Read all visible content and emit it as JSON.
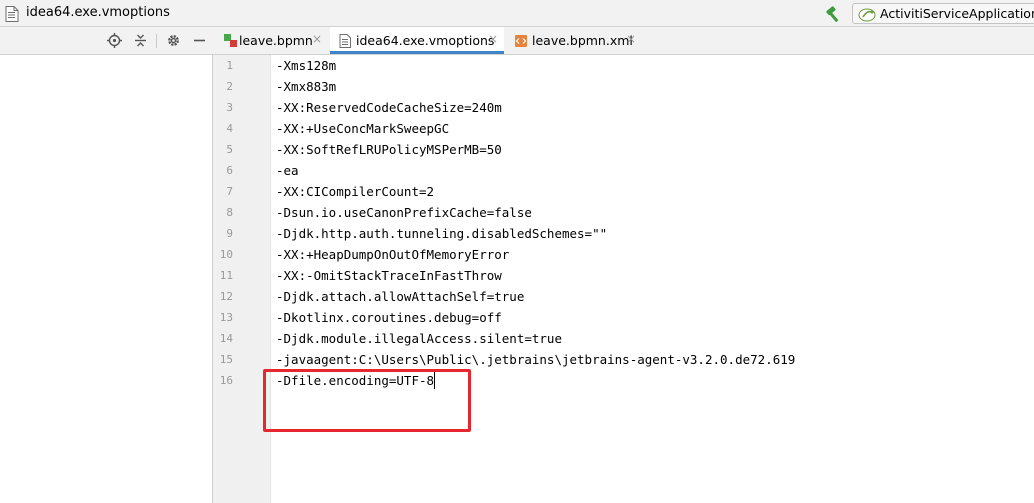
{
  "window": {
    "title": "idea64.exe.vmoptions",
    "run_config": "ActivitiServiceApplication"
  },
  "tabs": [
    {
      "label": "leave.bpmn",
      "active": false,
      "icon": "bpmn-file-icon"
    },
    {
      "label": "idea64.exe.vmoptions",
      "active": true,
      "icon": "text-file-icon"
    },
    {
      "label": "leave.bpmn.xml",
      "active": false,
      "icon": "xml-file-icon"
    }
  ],
  "tabs_close_glyph": "×",
  "toolbar_icons": [
    "locate-icon",
    "collapse-all-icon",
    "settings-icon",
    "hide-icon"
  ],
  "editor": {
    "current_line": 16,
    "lines": [
      {
        "num": "1",
        "text": "-Xms128m"
      },
      {
        "num": "2",
        "text": "-Xmx883m"
      },
      {
        "num": "3",
        "text": "-XX:ReservedCodeCacheSize=240m"
      },
      {
        "num": "4",
        "text": "-XX:+UseConcMarkSweepGC"
      },
      {
        "num": "5",
        "text": "-XX:SoftRefLRUPolicyMSPerMB=50"
      },
      {
        "num": "6",
        "text": "-ea"
      },
      {
        "num": "7",
        "text": "-XX:CICompilerCount=2"
      },
      {
        "num": "8",
        "text": "-Dsun.io.useCanonPrefixCache=false"
      },
      {
        "num": "9",
        "text": "-Djdk.http.auth.tunneling.disabledSchemes=\"\""
      },
      {
        "num": "10",
        "text": "-XX:+HeapDumpOnOutOfMemoryError"
      },
      {
        "num": "11",
        "text": "-XX:-OmitStackTraceInFastThrow"
      },
      {
        "num": "12",
        "text": "-Djdk.attach.allowAttachSelf=true"
      },
      {
        "num": "13",
        "text": "-Dkotlinx.coroutines.debug=off"
      },
      {
        "num": "14",
        "text": "-Djdk.module.illegalAccess.silent=true"
      },
      {
        "num": "15",
        "text": "-javaagent:C:\\Users\\Public\\.jetbrains\\jetbrains-agent-v3.2.0.de72.619"
      },
      {
        "num": "16",
        "text": "-Dfile.encoding=UTF-8"
      }
    ]
  },
  "colors": {
    "accent_tab_underline": "#4083c9",
    "highlight_box": "#e8262e",
    "current_line": "#fcfae8",
    "gutter": "#f0f0f0"
  }
}
